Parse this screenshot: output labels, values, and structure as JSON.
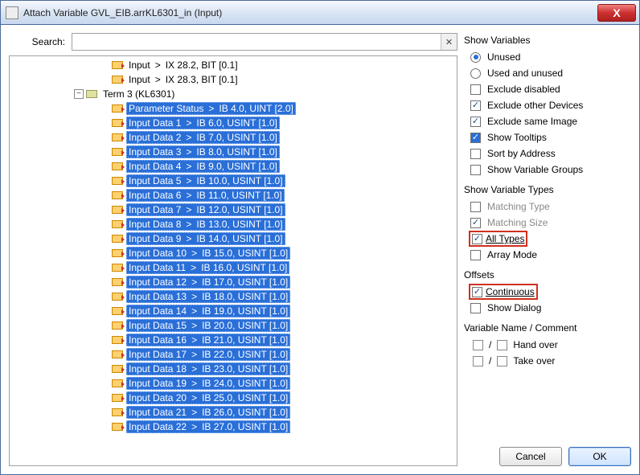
{
  "title": "Attach Variable GVL_EIB.arrKL6301_in (Input)",
  "search": {
    "label": "Search:",
    "value": "",
    "placeholder": ""
  },
  "tree": {
    "top_items": [
      {
        "label": "Input",
        "detail": "IX 28.2, BIT [0.1]"
      },
      {
        "label": "Input",
        "detail": "IX 28.3, BIT [0.1]"
      }
    ],
    "node_label": "Term 3 (KL6301)",
    "selected": [
      {
        "label": "Parameter Status",
        "detail": "IB 4.0, UINT [2.0]"
      },
      {
        "label": "Input Data 1",
        "detail": "IB 6.0, USINT [1.0]"
      },
      {
        "label": "Input Data 2",
        "detail": "IB 7.0, USINT [1.0]"
      },
      {
        "label": "Input Data 3",
        "detail": "IB 8.0, USINT [1.0]"
      },
      {
        "label": "Input Data 4",
        "detail": "IB 9.0, USINT [1.0]"
      },
      {
        "label": "Input Data 5",
        "detail": "IB 10.0, USINT [1.0]"
      },
      {
        "label": "Input Data 6",
        "detail": "IB 11.0, USINT [1.0]"
      },
      {
        "label": "Input Data 7",
        "detail": "IB 12.0, USINT [1.0]"
      },
      {
        "label": "Input Data 8",
        "detail": "IB 13.0, USINT [1.0]"
      },
      {
        "label": "Input Data 9",
        "detail": "IB 14.0, USINT [1.0]"
      },
      {
        "label": "Input Data 10",
        "detail": "IB 15.0, USINT [1.0]"
      },
      {
        "label": "Input Data 11",
        "detail": "IB 16.0, USINT [1.0]"
      },
      {
        "label": "Input Data 12",
        "detail": "IB 17.0, USINT [1.0]"
      },
      {
        "label": "Input Data 13",
        "detail": "IB 18.0, USINT [1.0]"
      },
      {
        "label": "Input Data 14",
        "detail": "IB 19.0, USINT [1.0]"
      },
      {
        "label": "Input Data 15",
        "detail": "IB 20.0, USINT [1.0]"
      },
      {
        "label": "Input Data 16",
        "detail": "IB 21.0, USINT [1.0]"
      },
      {
        "label": "Input Data 17",
        "detail": "IB 22.0, USINT [1.0]"
      },
      {
        "label": "Input Data 18",
        "detail": "IB 23.0, USINT [1.0]"
      },
      {
        "label": "Input Data 19",
        "detail": "IB 24.0, USINT [1.0]"
      },
      {
        "label": "Input Data 20",
        "detail": "IB 25.0, USINT [1.0]"
      },
      {
        "label": "Input Data 21",
        "detail": "IB 26.0, USINT [1.0]"
      },
      {
        "label": "Input Data 22",
        "detail": "IB 27.0, USINT [1.0]"
      }
    ]
  },
  "right": {
    "show_vars_title": "Show Variables",
    "unused": "Unused",
    "used_unused": "Used and unused",
    "exclude_disabled": "Exclude disabled",
    "exclude_other_devices": "Exclude other Devices",
    "exclude_same_image": "Exclude same Image",
    "show_tooltips": "Show Tooltips",
    "sort_by_address": "Sort by Address",
    "show_var_groups": "Show Variable Groups",
    "show_var_types_title": "Show Variable Types",
    "matching_type": "Matching Type",
    "matching_size": "Matching Size",
    "all_types": "All Types",
    "array_mode": "Array Mode",
    "offsets_title": "Offsets",
    "continuous": "Continuous",
    "show_dialog": "Show Dialog",
    "var_name_title": "Variable Name / Comment",
    "hand_over": "Hand over",
    "take_over": "Take over"
  },
  "buttons": {
    "cancel": "Cancel",
    "ok": "OK"
  }
}
